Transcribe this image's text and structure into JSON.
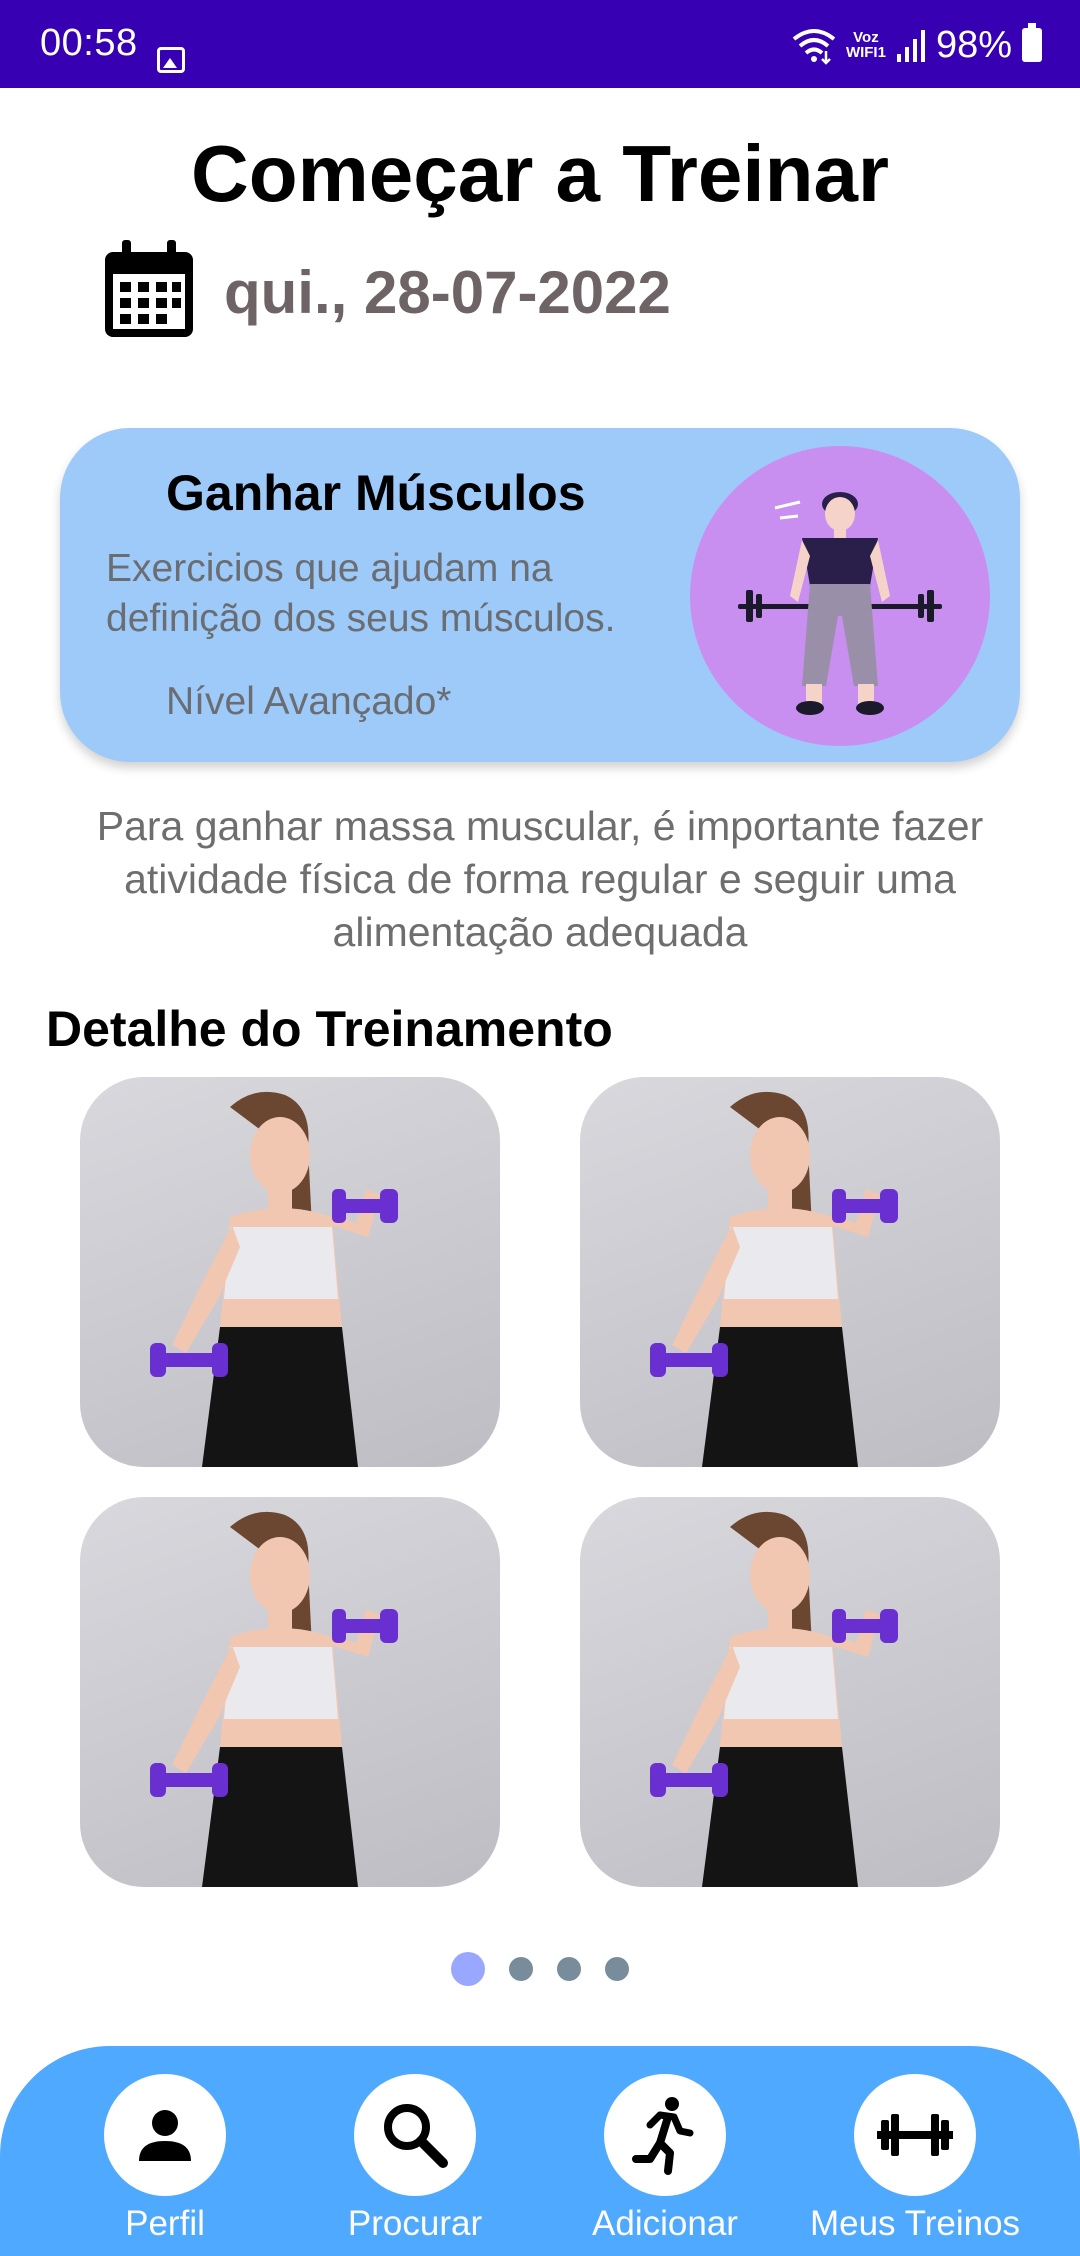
{
  "status_bar": {
    "time": "00:58",
    "voz_line1": "Voz",
    "voz_line2": "WIFI1",
    "battery": "98%",
    "icons": [
      "image-icon",
      "wifi-icon",
      "voz-wifi-icon",
      "signal-icon",
      "battery-icon"
    ]
  },
  "header": {
    "title": "Começar a Treinar",
    "date": "qui., 28-07-2022"
  },
  "goal_card": {
    "title": "Ganhar Músculos",
    "description": "Exercicios que ajudam na definição dos seus músculos.",
    "level": "Nível Avançado*"
  },
  "info": {
    "text": "Para ganhar massa muscular, é importante fazer atividade física de forma regular e seguir uma alimentação adequada"
  },
  "training": {
    "section_title": "Detalhe do Treinamento",
    "cards_count": 4
  },
  "pager": {
    "pages": 4,
    "active_index": 0
  },
  "bottom_nav": {
    "items": [
      {
        "label": "Perfil",
        "icon": "person-icon"
      },
      {
        "label": "Procurar",
        "icon": "search-icon"
      },
      {
        "label": "Adicionar",
        "icon": "running-icon"
      },
      {
        "label": "Meus Treinos",
        "icon": "barbell-icon"
      }
    ]
  },
  "colors": {
    "status_bar": "#3700b3",
    "card_background": "#9ecafa",
    "illustration_circle": "#c98ff0",
    "bottom_nav": "#4ea9ff",
    "pager_active": "#9aa7ff",
    "pager_inactive": "#798c9b",
    "dumbbell": "#6a2fd1"
  }
}
